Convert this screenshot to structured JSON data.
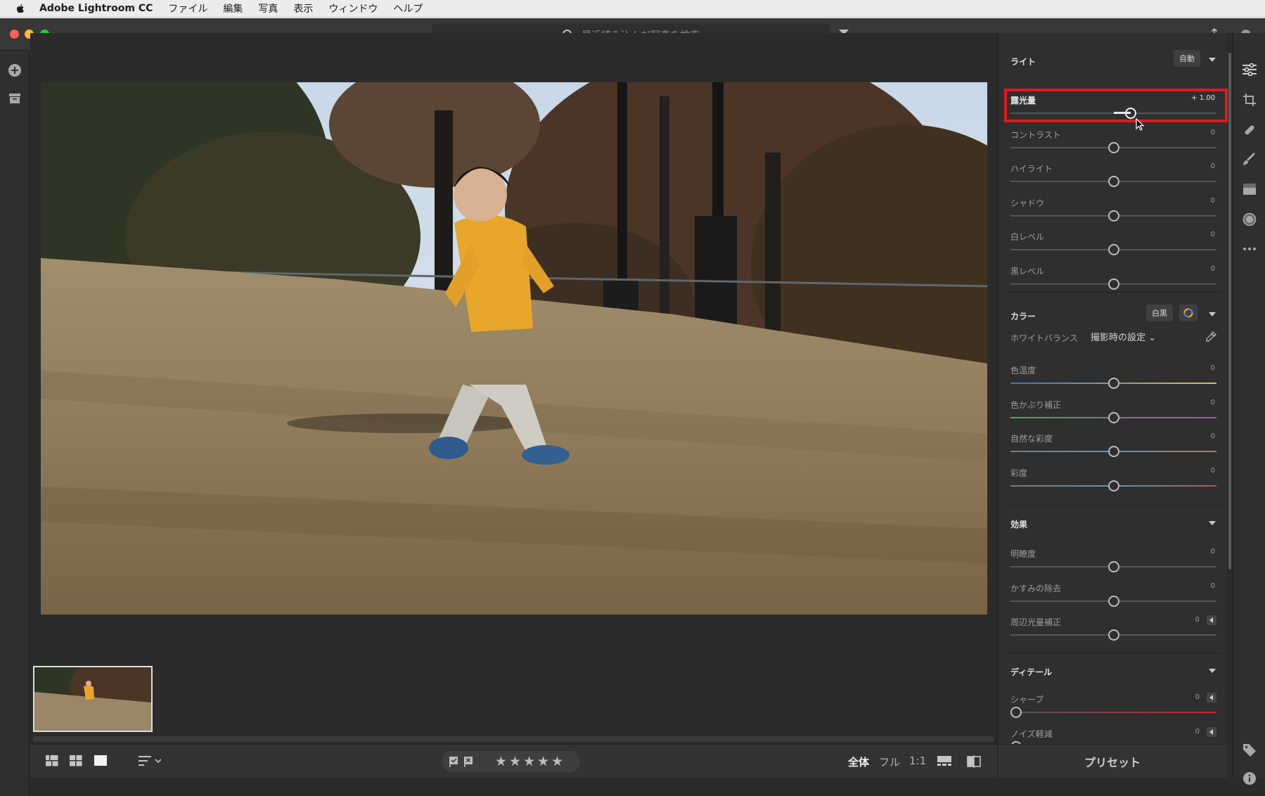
{
  "menubar": {
    "app_name": "Adobe Lightroom CC",
    "items": [
      "ファイル",
      "編集",
      "写真",
      "表示",
      "ウィンドウ",
      "ヘルプ"
    ]
  },
  "search": {
    "placeholder": "最近読み込んだ写真を検索"
  },
  "light_section": {
    "title": "ライト",
    "auto_label": "自動",
    "sliders": [
      {
        "label": "露光量",
        "value": "+ 1.00",
        "position": 0.59
      },
      {
        "label": "コントラスト",
        "value": "0",
        "position": 0.5
      },
      {
        "label": "ハイライト",
        "value": "0",
        "position": 0.5
      },
      {
        "label": "シャドウ",
        "value": "0",
        "position": 0.5
      },
      {
        "label": "白レベル",
        "value": "0",
        "position": 0.5
      },
      {
        "label": "黒レベル",
        "value": "0",
        "position": 0.5
      }
    ]
  },
  "color_section": {
    "title": "カラー",
    "bw_label": "白黒",
    "white_balance_label": "ホワイトバランス",
    "white_balance_value": "撮影時の設定",
    "sliders": [
      {
        "label": "色温度",
        "value": "0",
        "position": 0.5
      },
      {
        "label": "色かぶり補正",
        "value": "0",
        "position": 0.5
      },
      {
        "label": "自然な彩度",
        "value": "0",
        "position": 0.5
      },
      {
        "label": "彩度",
        "value": "0",
        "position": 0.5
      }
    ]
  },
  "effects_section": {
    "title": "効果",
    "sliders": [
      {
        "label": "明瞭度",
        "value": "0",
        "position": 0.5
      },
      {
        "label": "かすみの除去",
        "value": "0",
        "position": 0.5
      },
      {
        "label": "周辺光量補正",
        "value": "0",
        "position": 0.5
      }
    ]
  },
  "detail_section": {
    "title": "ディテール",
    "sliders": [
      {
        "label": "シャープ",
        "value": "0",
        "position": 0.0
      },
      {
        "label": "ノイズ軽減",
        "value": "0",
        "position": 0.0
      }
    ]
  },
  "bottombar": {
    "stars": "★★★★★",
    "zoom_fit": "全体",
    "zoom_fill": "フル",
    "zoom_1to1": "1:1"
  },
  "preset_label": "プリセット",
  "colors": {
    "highlight": "#e3181f",
    "jacket": "#e8a62a",
    "panel_bg": "#2f2f2f"
  }
}
